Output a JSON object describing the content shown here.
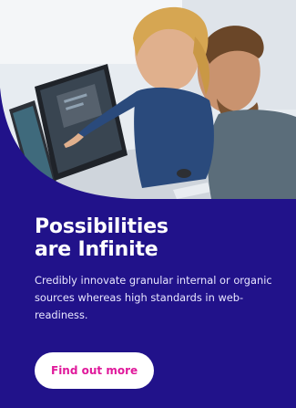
{
  "promo": {
    "image_alt": "photo-two-people-at-computer",
    "headline_line1": "Possibilities",
    "headline_line2": "are Infinite",
    "body": "Credibly innovate granular internal or organic sources whereas high standards in web-readiness.",
    "cta_label": "Find out more"
  },
  "colors": {
    "background": "#21128a",
    "headline": "#ffffff",
    "body_text": "#e8e6ff",
    "button_bg": "#ffffff",
    "button_text": "#e0199b"
  }
}
